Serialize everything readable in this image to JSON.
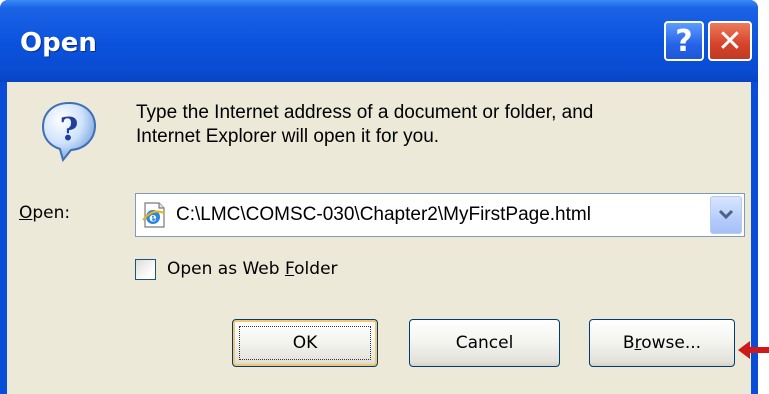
{
  "window": {
    "title": "Open",
    "help_glyph": "?",
    "close_glyph": "✕",
    "colors": {
      "titlebar": "#0a4ed8",
      "face": "#ece9d8",
      "close": "#d5432a"
    }
  },
  "message": {
    "line1": "Type the Internet address of a document or folder, and",
    "line2": "Internet Explorer will open it for you."
  },
  "open_field": {
    "label_mnemonic": "O",
    "label_rest": "pen:",
    "value": "C:\\LMC\\COMSC-030\\Chapter2\\MyFirstPage.html",
    "icon": "ie-page-icon"
  },
  "web_folder": {
    "label_before": "Open as Web ",
    "label_mnemonic": "F",
    "label_after": "older",
    "checked": false
  },
  "buttons": {
    "ok": "OK",
    "cancel": "Cancel",
    "browse_before": "B",
    "browse_mnemonic": "r",
    "browse_after": "owse..."
  },
  "annotation": {
    "icon": "red-arrow-icon",
    "color": "#cc1a1a"
  }
}
